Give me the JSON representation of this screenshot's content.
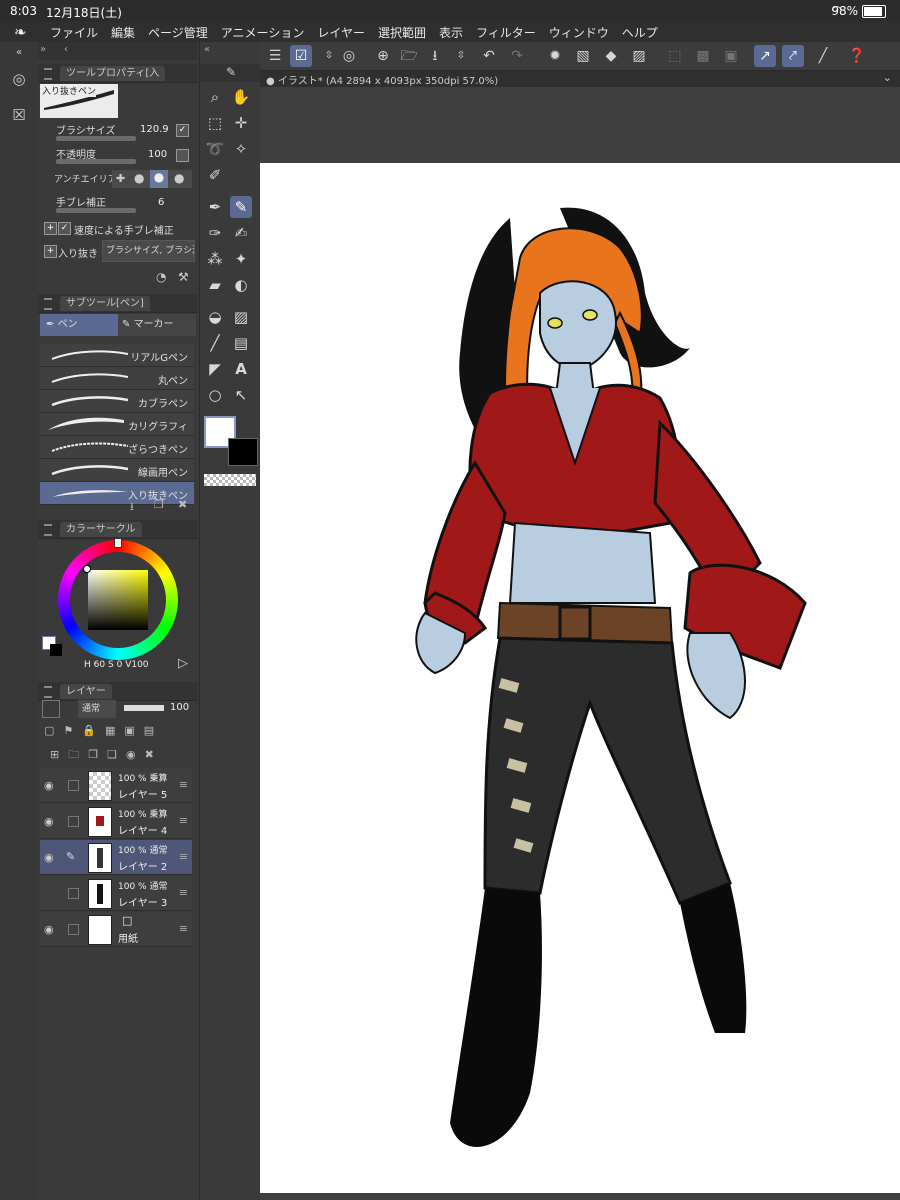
{
  "status_bar": {
    "time": "8:03",
    "date": "12月18日(土)",
    "battery": "98%"
  },
  "menu": {
    "items": [
      "ファイル",
      "編集",
      "ページ管理",
      "アニメーション",
      "レイヤー",
      "選択範囲",
      "表示",
      "フィルター",
      "ウィンドウ",
      "ヘルプ"
    ]
  },
  "tool_property": {
    "tab": "ツールプロパティ[入",
    "brush_name": "入り抜きペン",
    "brush_size_label": "ブラシサイズ",
    "brush_size": "120.9",
    "opacity_label": "不透明度",
    "opacity": "100",
    "antialias_label": "アンチエイリアス",
    "stabilize_label": "手ブレ補正",
    "stabilize": "6",
    "speed_stabilize_label": "速度による手ブレ補正",
    "taper_label": "入り抜き",
    "taper_value": "ブラシサイズ, ブラシ濃"
  },
  "subtool": {
    "tab": "サブツール[ペン]",
    "groups": [
      "ペン",
      "マーカー"
    ],
    "brushes": [
      "リアルGペン",
      "丸ペン",
      "カブラペン",
      "カリグラフィ",
      "ざらつきペン",
      "線画用ペン",
      "入り抜きペン"
    ]
  },
  "color": {
    "tab": "カラーサークル",
    "hsv": {
      "h_label": "H",
      "h": "60",
      "s_label": "S",
      "s": "0",
      "v_label": "V",
      "v": "100"
    }
  },
  "layers": {
    "tab": "レイヤー",
    "blend_mode": "通常",
    "opacity": "100",
    "items": [
      {
        "mode": "100 % 乗算",
        "name": "レイヤー 5"
      },
      {
        "mode": "100 % 乗算",
        "name": "レイヤー 4"
      },
      {
        "mode": "100 % 通常",
        "name": "レイヤー 2"
      },
      {
        "mode": "100 % 通常",
        "name": "レイヤー 3"
      },
      {
        "mode": "",
        "name": "用紙"
      }
    ]
  },
  "document": {
    "title": "イラスト* (A4 2894 x 4093px 350dpi 57.0%)"
  },
  "colors": {
    "accent": "#5b6a92",
    "shirt_red": "#a01818",
    "hair_orange": "#e8751e",
    "skin": "#b9cde0"
  }
}
